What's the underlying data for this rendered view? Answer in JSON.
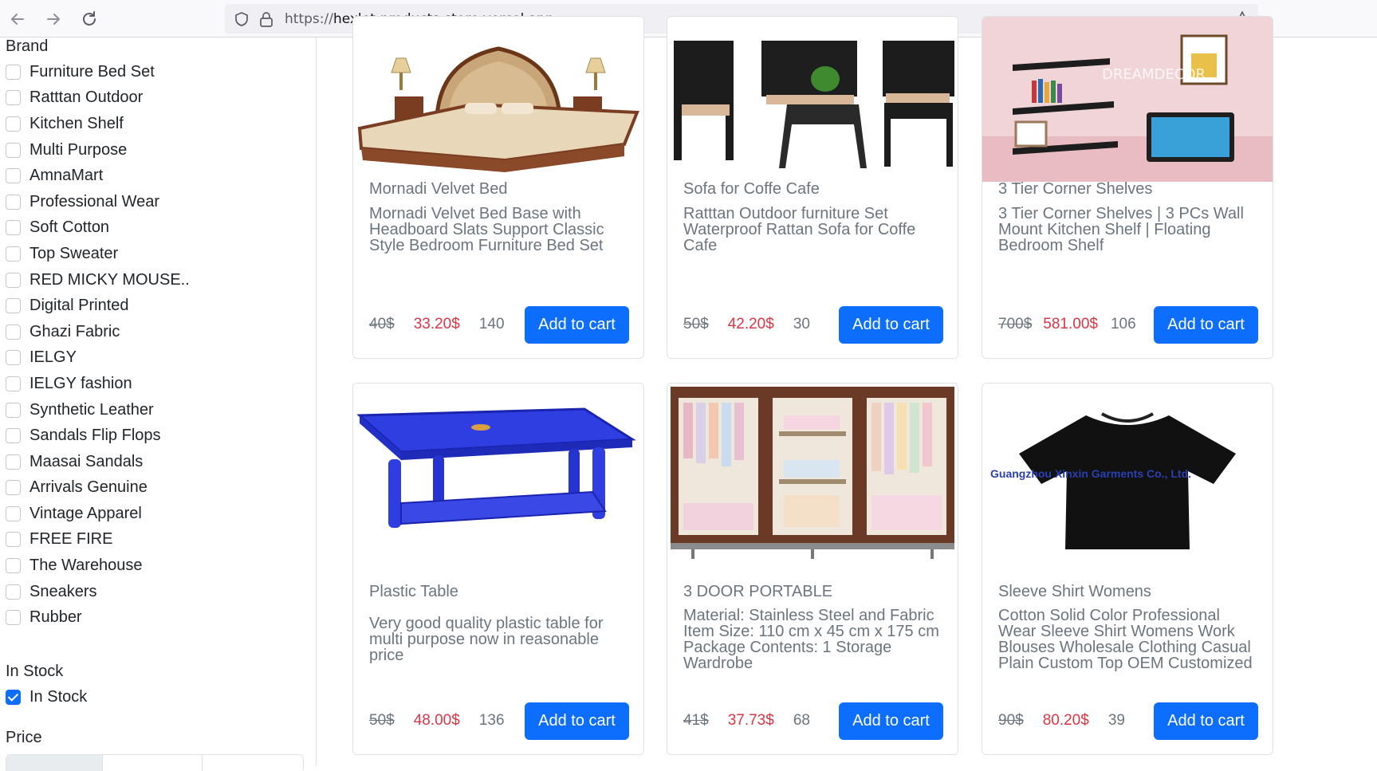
{
  "browser": {
    "url_protocol": "https://",
    "url_host": "hexlet-products-store.vercel.app"
  },
  "sidebar": {
    "brand_title": "Brand",
    "brands": [
      {
        "label": "Furniture Bed Set",
        "checked": false
      },
      {
        "label": "Ratttan Outdoor",
        "checked": false
      },
      {
        "label": "Kitchen Shelf",
        "checked": false
      },
      {
        "label": "Multi Purpose",
        "checked": false
      },
      {
        "label": "AmnaMart",
        "checked": false
      },
      {
        "label": "Professional Wear",
        "checked": false
      },
      {
        "label": "Soft Cotton",
        "checked": false
      },
      {
        "label": "Top Sweater",
        "checked": false
      },
      {
        "label": "RED MICKY MOUSE..",
        "checked": false
      },
      {
        "label": "Digital Printed",
        "checked": false
      },
      {
        "label": "Ghazi Fabric",
        "checked": false
      },
      {
        "label": "IELGY",
        "checked": false
      },
      {
        "label": "IELGY fashion",
        "checked": false
      },
      {
        "label": "Synthetic Leather",
        "checked": false
      },
      {
        "label": "Sandals Flip Flops",
        "checked": false
      },
      {
        "label": "Maasai Sandals",
        "checked": false
      },
      {
        "label": "Arrivals Genuine",
        "checked": false
      },
      {
        "label": "Vintage Apparel",
        "checked": false
      },
      {
        "label": "FREE FIRE",
        "checked": false
      },
      {
        "label": "The Warehouse",
        "checked": false
      },
      {
        "label": "Sneakers",
        "checked": false
      },
      {
        "label": "Rubber",
        "checked": false
      }
    ],
    "stock_title": "In Stock",
    "stock_option": {
      "label": "In Stock",
      "checked": true
    },
    "price_title": "Price"
  },
  "products": [
    {
      "title": "Mornadi Velvet Bed",
      "description": "Mornadi Velvet Bed Base with Headboard Slats Support Classic Style Bedroom Furniture Bed Set",
      "old_price": "40$",
      "price": "33.20$",
      "stock": "140",
      "button": "Add to cart",
      "image": "bed"
    },
    {
      "title": "Sofa for Coffe Cafe",
      "description": "Ratttan Outdoor furniture Set Waterproof Rattan Sofa for Coffe Cafe",
      "old_price": "50$",
      "price": "42.20$",
      "stock": "30",
      "button": "Add to cart",
      "image": "rattan-sofa"
    },
    {
      "title": "3 Tier Corner Shelves",
      "description": "3 Tier Corner Shelves | 3 PCs Wall Mount Kitchen Shelf | Floating Bedroom Shelf",
      "old_price": "700$",
      "price": "581.00$",
      "stock": "106",
      "button": "Add to cart",
      "image": "corner-shelves",
      "image_watermark": "DREAMDECOR"
    },
    {
      "title": "Plastic Table",
      "description": "Very good quality plastic table for multi purpose now in reasonable price",
      "old_price": "50$",
      "price": "48.00$",
      "stock": "136",
      "button": "Add to cart",
      "image": "plastic-table"
    },
    {
      "title": "3 DOOR PORTABLE",
      "description": "Material: Stainless Steel and Fabric Item Size: 110 cm x 45 cm x 175 cm Package Contents: 1 Storage Wardrobe",
      "old_price": "41$",
      "price": "37.73$",
      "stock": "68",
      "button": "Add to cart",
      "image": "wardrobe"
    },
    {
      "title": "Sleeve Shirt Womens",
      "description": "Cotton Solid Color Professional Wear Sleeve Shirt Womens Work Blouses Wholesale Clothing Casual Plain Custom Top OEM Customized",
      "old_price": "90$",
      "price": "80.20$",
      "stock": "39",
      "button": "Add to cart",
      "image": "tshirt",
      "image_watermark": "Guangzhou Xinxin Garments Co., Ltd."
    }
  ]
}
